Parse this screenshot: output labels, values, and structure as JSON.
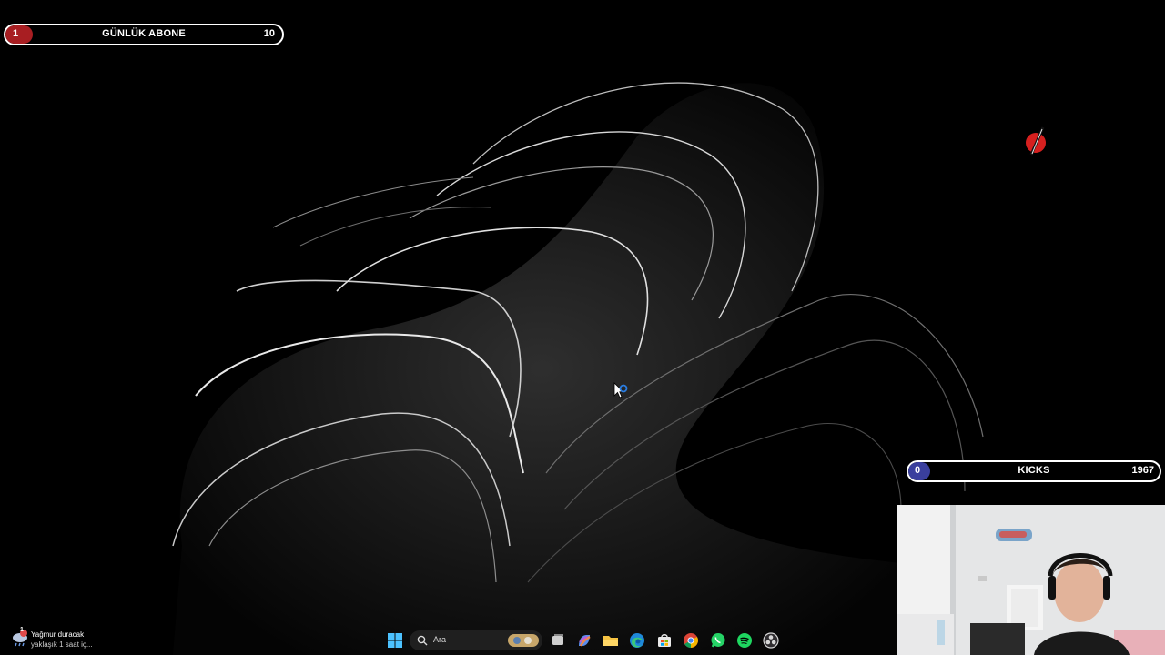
{
  "overlays": {
    "subscriber_goal": {
      "current": "1",
      "title": "GÜNLÜK ABONE",
      "target": "10",
      "progress": 0.1,
      "fill_color": "#a81e22"
    },
    "kicks_goal": {
      "current": "0",
      "title": "KICKS",
      "target": "1967",
      "progress": 0.0,
      "fill_color": "#3a3f9e"
    }
  },
  "desktop": {
    "wallpaper": "dark-abstract-bloom",
    "logo_icon": "red-slash-logo-icon"
  },
  "taskbar": {
    "weather": {
      "line1": "Yağmur duracak",
      "line2": "yaklaşık 1 saat iç...",
      "badge": "1"
    },
    "search": {
      "placeholder": "Ara"
    },
    "apps": [
      "windows-start-icon",
      "search-icon",
      "task-view-icon",
      "copilot-icon",
      "file-explorer-icon",
      "edge-icon",
      "store-icon",
      "chrome-icon",
      "whatsapp-icon",
      "spotify-icon",
      "obs-icon"
    ]
  },
  "webcam": {
    "label": "streamer-webcam"
  }
}
